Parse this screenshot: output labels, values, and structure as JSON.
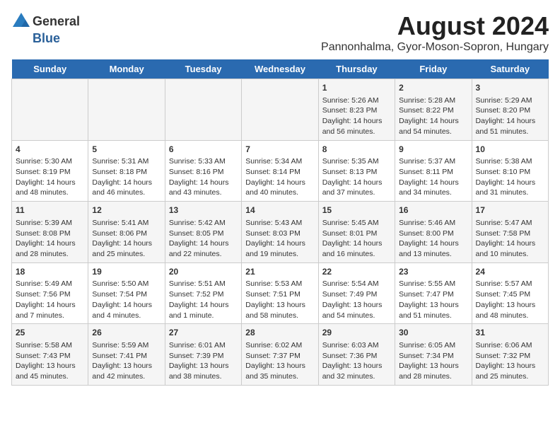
{
  "header": {
    "logo_line1": "General",
    "logo_line2": "Blue",
    "title": "August 2024",
    "subtitle": "Pannonhalma, Gyor-Moson-Sopron, Hungary"
  },
  "weekdays": [
    "Sunday",
    "Monday",
    "Tuesday",
    "Wednesday",
    "Thursday",
    "Friday",
    "Saturday"
  ],
  "weeks": [
    [
      {
        "day": "",
        "info": ""
      },
      {
        "day": "",
        "info": ""
      },
      {
        "day": "",
        "info": ""
      },
      {
        "day": "",
        "info": ""
      },
      {
        "day": "1",
        "info": "Sunrise: 5:26 AM\nSunset: 8:23 PM\nDaylight: 14 hours and 56 minutes."
      },
      {
        "day": "2",
        "info": "Sunrise: 5:28 AM\nSunset: 8:22 PM\nDaylight: 14 hours and 54 minutes."
      },
      {
        "day": "3",
        "info": "Sunrise: 5:29 AM\nSunset: 8:20 PM\nDaylight: 14 hours and 51 minutes."
      }
    ],
    [
      {
        "day": "4",
        "info": "Sunrise: 5:30 AM\nSunset: 8:19 PM\nDaylight: 14 hours and 48 minutes."
      },
      {
        "day": "5",
        "info": "Sunrise: 5:31 AM\nSunset: 8:18 PM\nDaylight: 14 hours and 46 minutes."
      },
      {
        "day": "6",
        "info": "Sunrise: 5:33 AM\nSunset: 8:16 PM\nDaylight: 14 hours and 43 minutes."
      },
      {
        "day": "7",
        "info": "Sunrise: 5:34 AM\nSunset: 8:14 PM\nDaylight: 14 hours and 40 minutes."
      },
      {
        "day": "8",
        "info": "Sunrise: 5:35 AM\nSunset: 8:13 PM\nDaylight: 14 hours and 37 minutes."
      },
      {
        "day": "9",
        "info": "Sunrise: 5:37 AM\nSunset: 8:11 PM\nDaylight: 14 hours and 34 minutes."
      },
      {
        "day": "10",
        "info": "Sunrise: 5:38 AM\nSunset: 8:10 PM\nDaylight: 14 hours and 31 minutes."
      }
    ],
    [
      {
        "day": "11",
        "info": "Sunrise: 5:39 AM\nSunset: 8:08 PM\nDaylight: 14 hours and 28 minutes."
      },
      {
        "day": "12",
        "info": "Sunrise: 5:41 AM\nSunset: 8:06 PM\nDaylight: 14 hours and 25 minutes."
      },
      {
        "day": "13",
        "info": "Sunrise: 5:42 AM\nSunset: 8:05 PM\nDaylight: 14 hours and 22 minutes."
      },
      {
        "day": "14",
        "info": "Sunrise: 5:43 AM\nSunset: 8:03 PM\nDaylight: 14 hours and 19 minutes."
      },
      {
        "day": "15",
        "info": "Sunrise: 5:45 AM\nSunset: 8:01 PM\nDaylight: 14 hours and 16 minutes."
      },
      {
        "day": "16",
        "info": "Sunrise: 5:46 AM\nSunset: 8:00 PM\nDaylight: 14 hours and 13 minutes."
      },
      {
        "day": "17",
        "info": "Sunrise: 5:47 AM\nSunset: 7:58 PM\nDaylight: 14 hours and 10 minutes."
      }
    ],
    [
      {
        "day": "18",
        "info": "Sunrise: 5:49 AM\nSunset: 7:56 PM\nDaylight: 14 hours and 7 minutes."
      },
      {
        "day": "19",
        "info": "Sunrise: 5:50 AM\nSunset: 7:54 PM\nDaylight: 14 hours and 4 minutes."
      },
      {
        "day": "20",
        "info": "Sunrise: 5:51 AM\nSunset: 7:52 PM\nDaylight: 14 hours and 1 minute."
      },
      {
        "day": "21",
        "info": "Sunrise: 5:53 AM\nSunset: 7:51 PM\nDaylight: 13 hours and 58 minutes."
      },
      {
        "day": "22",
        "info": "Sunrise: 5:54 AM\nSunset: 7:49 PM\nDaylight: 13 hours and 54 minutes."
      },
      {
        "day": "23",
        "info": "Sunrise: 5:55 AM\nSunset: 7:47 PM\nDaylight: 13 hours and 51 minutes."
      },
      {
        "day": "24",
        "info": "Sunrise: 5:57 AM\nSunset: 7:45 PM\nDaylight: 13 hours and 48 minutes."
      }
    ],
    [
      {
        "day": "25",
        "info": "Sunrise: 5:58 AM\nSunset: 7:43 PM\nDaylight: 13 hours and 45 minutes."
      },
      {
        "day": "26",
        "info": "Sunrise: 5:59 AM\nSunset: 7:41 PM\nDaylight: 13 hours and 42 minutes."
      },
      {
        "day": "27",
        "info": "Sunrise: 6:01 AM\nSunset: 7:39 PM\nDaylight: 13 hours and 38 minutes."
      },
      {
        "day": "28",
        "info": "Sunrise: 6:02 AM\nSunset: 7:37 PM\nDaylight: 13 hours and 35 minutes."
      },
      {
        "day": "29",
        "info": "Sunrise: 6:03 AM\nSunset: 7:36 PM\nDaylight: 13 hours and 32 minutes."
      },
      {
        "day": "30",
        "info": "Sunrise: 6:05 AM\nSunset: 7:34 PM\nDaylight: 13 hours and 28 minutes."
      },
      {
        "day": "31",
        "info": "Sunrise: 6:06 AM\nSunset: 7:32 PM\nDaylight: 13 hours and 25 minutes."
      }
    ]
  ]
}
